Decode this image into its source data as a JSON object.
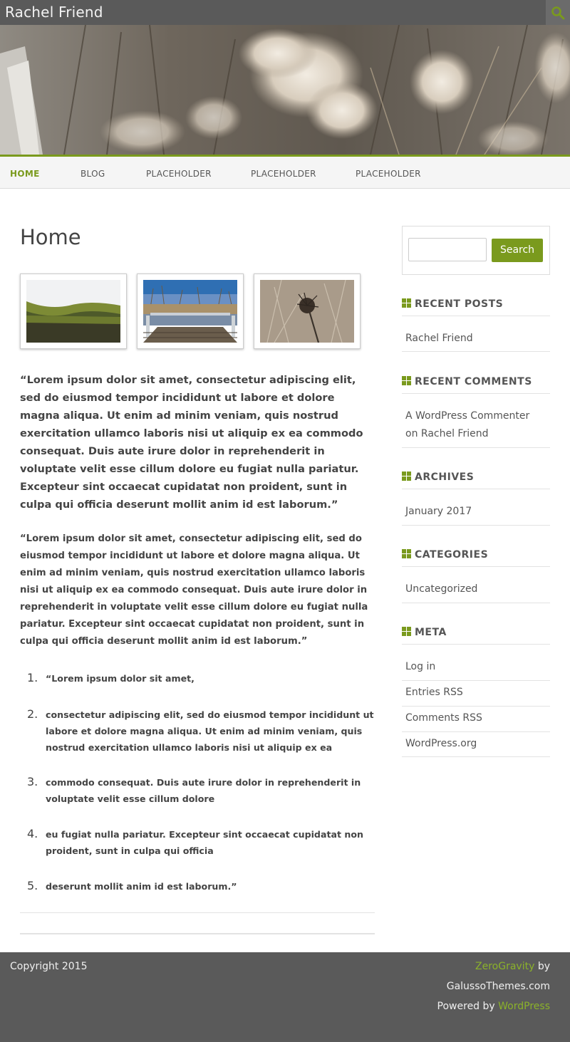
{
  "site": {
    "title": "Rachel Friend"
  },
  "nav": {
    "items": [
      "HOME",
      "BLOG",
      "PLACEHOLDER",
      "PLACEHOLDER",
      "PLACEHOLDER"
    ],
    "accent": "#7a9a1d"
  },
  "page": {
    "title": "Home",
    "paragraph_large": "“Lorem ipsum dolor sit amet, consectetur adipiscing elit, sed do eiusmod tempor incididunt ut labore et dolore magna aliqua. Ut enim ad minim veniam, quis nostrud exercitation ullamco laboris nisi ut aliquip ex ea commodo consequat. Duis aute irure dolor in reprehenderit in voluptate velit esse cillum dolore eu fugiat nulla pariatur. Excepteur sint occaecat cupidatat non proident, sunt in culpa qui officia deserunt mollit anim id est laborum.”",
    "paragraph_medium": "“Lorem ipsum dolor sit amet, consectetur adipiscing elit, sed do eiusmod tempor incididunt ut labore et dolore magna aliqua. Ut enim ad minim veniam, quis nostrud exercitation ullamco laboris nisi ut aliquip ex ea commodo consequat. Duis aute irure dolor in reprehenderit in voluptate velit esse cillum dolore eu fugiat nulla pariatur. Excepteur sint occaecat cupidatat non proident, sunt in culpa qui officia deserunt mollit anim id est laborum.”",
    "list": [
      {
        "num": "1.",
        "text": "“Lorem ipsum dolor sit amet,"
      },
      {
        "num": "2.",
        "text": "consectetur adipiscing elit, sed do eiusmod tempor incididunt ut labore et dolore magna aliqua. Ut enim ad minim veniam, quis nostrud exercitation ullamco laboris nisi ut aliquip ex ea"
      },
      {
        "num": "3.",
        "text": "commodo consequat. Duis aute irure dolor in reprehenderit in voluptate velit esse cillum dolore"
      },
      {
        "num": "4.",
        "text": "eu fugiat nulla pariatur. Excepteur sint occaecat cupidatat non proident, sunt in culpa qui officia"
      },
      {
        "num": "5.",
        "text": "deserunt mollit anim id est laborum.”"
      }
    ]
  },
  "sidebar": {
    "search": {
      "placeholder": "",
      "button": "Search"
    },
    "recent_posts": {
      "title": "RECENT POSTS",
      "items": [
        "Rachel Friend"
      ]
    },
    "recent_comments": {
      "title": "RECENT COMMENTS",
      "author": "A WordPress Commenter",
      "on": "on",
      "post": "Rachel Friend"
    },
    "archives": {
      "title": "ARCHIVES",
      "items": [
        "January 2017"
      ]
    },
    "categories": {
      "title": "CATEGORIES",
      "items": [
        "Uncategorized"
      ]
    },
    "meta": {
      "title": "META",
      "items": [
        "Log in",
        "Entries RSS",
        "Comments RSS",
        "WordPress.org"
      ]
    }
  },
  "footer": {
    "copyright": "Copyright 2015",
    "theme_link": "ZeroGravity",
    "by": "by",
    "company": "GalussoThemes.com",
    "powered": "Powered by",
    "wp_link": "WordPress"
  }
}
